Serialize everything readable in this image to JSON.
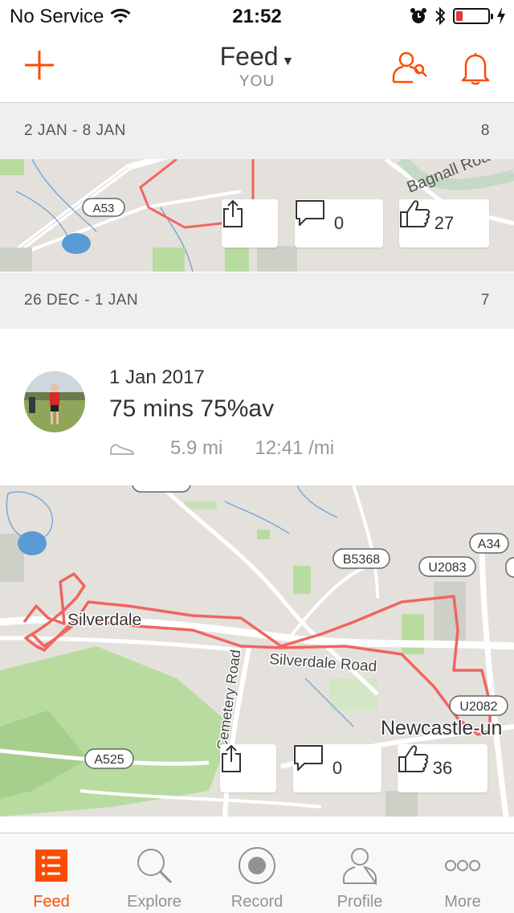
{
  "status_bar": {
    "carrier": "No Service",
    "time": "21:52",
    "battery_level": 0.2
  },
  "header": {
    "title": "Feed",
    "subtitle": "YOU"
  },
  "weeks": [
    {
      "range": "2 JAN - 8 JAN",
      "count": "8"
    },
    {
      "range": "26 DEC - 1 JAN",
      "count": "7"
    }
  ],
  "map1": {
    "road_labels": [
      "A53",
      "Bagnall Road"
    ],
    "comments": "0",
    "kudos": "27"
  },
  "activity": {
    "date": "1 Jan 2017",
    "title": "75 mins 75%av",
    "distance": "5.9 mi",
    "pace": "12:41 /mi"
  },
  "map2": {
    "road_labels": [
      "B5368",
      "U2083",
      "A34",
      "U2082",
      "A525"
    ],
    "place_labels": [
      "Silverdale",
      "Silverdale Road",
      "Cemetery Road",
      "Newcastle-un"
    ],
    "comments": "0",
    "kudos": "36"
  },
  "tabs": [
    {
      "label": "Feed",
      "icon": "feed-icon",
      "active": true
    },
    {
      "label": "Explore",
      "icon": "explore-icon",
      "active": false
    },
    {
      "label": "Record",
      "icon": "record-icon",
      "active": false
    },
    {
      "label": "Profile",
      "icon": "profile-icon",
      "active": false
    },
    {
      "label": "More",
      "icon": "more-icon",
      "active": false
    }
  ],
  "colors": {
    "accent": "#fc4c02",
    "route": "#f06560",
    "map_bg": "#e4e1dc",
    "park": "#b8dca0"
  }
}
